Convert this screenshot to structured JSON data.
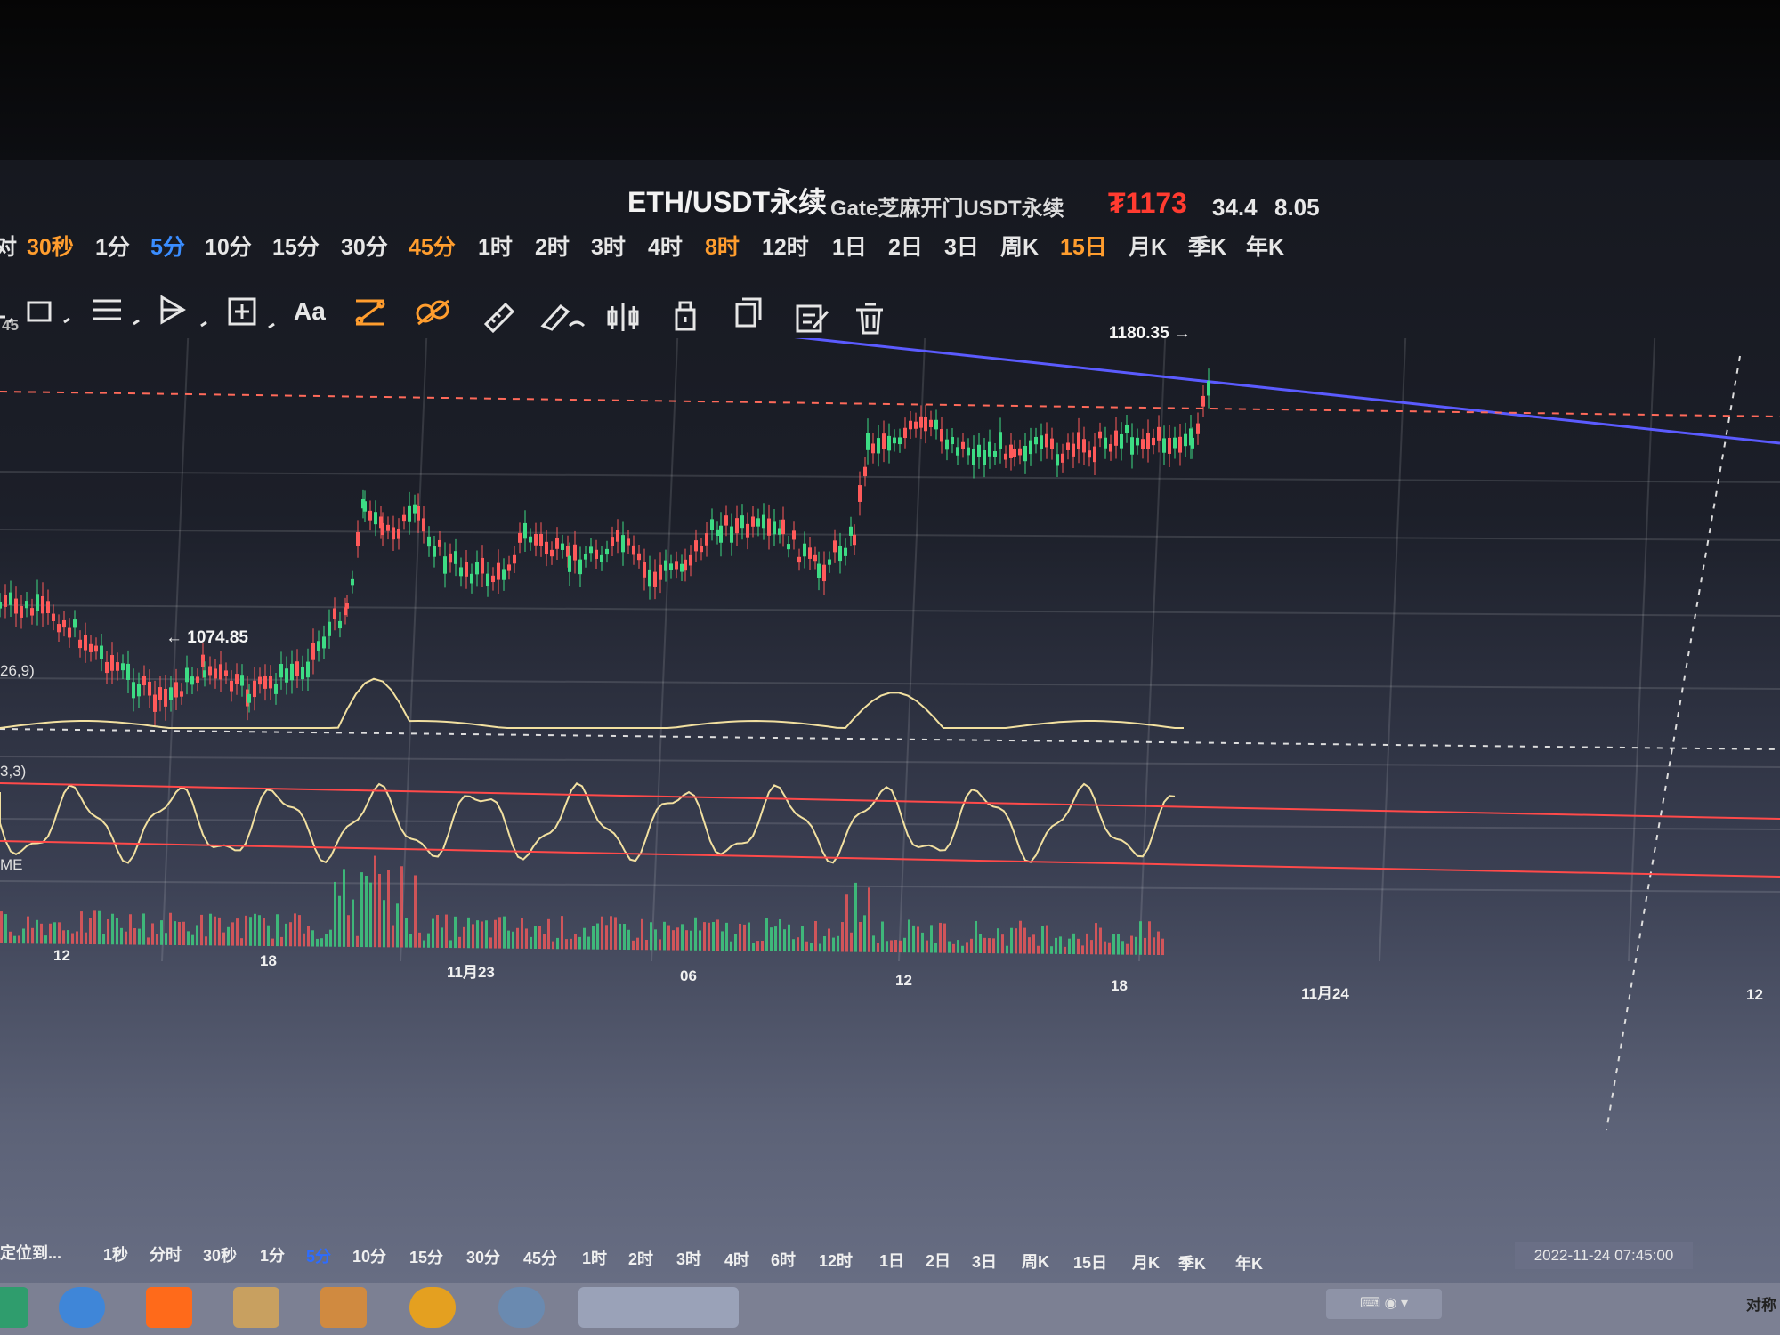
{
  "header": {
    "symbol": "ETH/USDT永续",
    "exchange": "Gate芝麻开门USDT永续",
    "price": "₮1173",
    "change": "34.4",
    "change_pct": "8.05"
  },
  "periods": [
    {
      "label": "30秒",
      "state": "orange"
    },
    {
      "label": "1分",
      "state": "normal"
    },
    {
      "label": "5分",
      "state": "selected"
    },
    {
      "label": "10分",
      "state": "normal"
    },
    {
      "label": "15分",
      "state": "normal"
    },
    {
      "label": "30分",
      "state": "normal"
    },
    {
      "label": "45分",
      "state": "orange"
    },
    {
      "label": "1时",
      "state": "normal"
    },
    {
      "label": "2时",
      "state": "normal"
    },
    {
      "label": "3时",
      "state": "normal"
    },
    {
      "label": "4时",
      "state": "normal"
    },
    {
      "label": "8时",
      "state": "orange"
    },
    {
      "label": "12时",
      "state": "normal"
    },
    {
      "label": "1日",
      "state": "normal"
    },
    {
      "label": "2日",
      "state": "normal"
    },
    {
      "label": "3日",
      "state": "normal"
    },
    {
      "label": "周K",
      "state": "normal"
    },
    {
      "label": "15日",
      "state": "orange"
    },
    {
      "label": "月K",
      "state": "normal"
    },
    {
      "label": "季K",
      "state": "normal"
    },
    {
      "label": "年K",
      "state": "normal"
    }
  ],
  "tools": {
    "text_tool": "Aa"
  },
  "chart": {
    "high_label": "1180.35 →",
    "low_label": "← 1074.85",
    "axis_stub": "45",
    "macd_label": "26,9)",
    "kdj_label": "3,3)",
    "vol_label": "ME",
    "x_ticks": [
      "12",
      "18",
      "11月23",
      "06",
      "12",
      "18",
      "11月24",
      "12"
    ],
    "crosshair_time": "2022-11-24 07:45:00"
  },
  "bottom_bar": {
    "locate": "定位到...",
    "periods": [
      "1秒",
      "分时",
      "30秒",
      "1分",
      "5分",
      "10分",
      "15分",
      "30分",
      "45分",
      "1时",
      "2时",
      "3时",
      "4时",
      "6时",
      "12时",
      "1日",
      "2日",
      "3日",
      "周K",
      "15日",
      "月K",
      "季K",
      "年K"
    ],
    "selected": "5分"
  },
  "taskbar": {
    "right_text": "对称"
  },
  "colors": {
    "up": "#3ddc84",
    "down": "#ff5a5a",
    "trendline": "#5b5bff",
    "dashed": "#ff6a5a",
    "selected_period": "#3a8dff",
    "highlight_period": "#ff9d2e",
    "price": "#ff3b30"
  }
}
